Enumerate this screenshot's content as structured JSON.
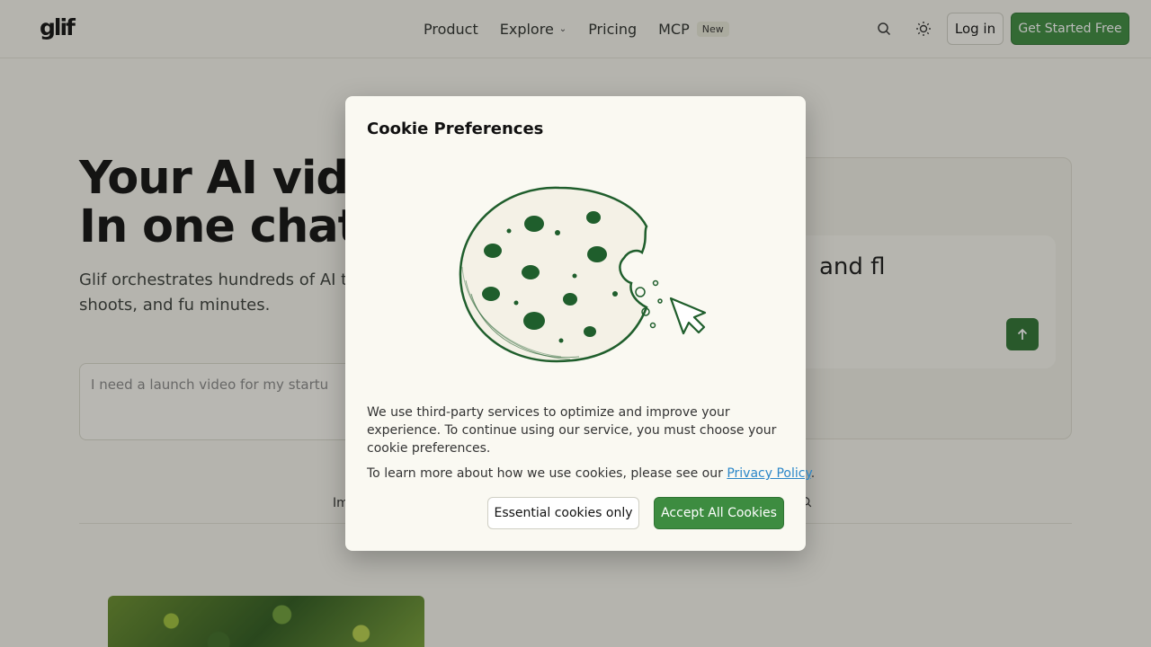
{
  "header": {
    "logo": "glif",
    "nav": {
      "product": "Product",
      "explore": "Explore",
      "pricing": "Pricing",
      "mcp": "MCP",
      "mcp_badge": "New"
    },
    "search_icon": "search-icon",
    "theme_icon": "sun-icon",
    "login_label": "Log in",
    "get_started_label": "Get Started Free"
  },
  "hero": {
    "title_line1": "Your AI vide",
    "title_line2": "In one chat.",
    "subtitle": "Glif orchestrates hundreds of AI to form videos, product shoots, and fu minutes.",
    "prompt_placeholder": "I need a launch video for my startu",
    "preview_text": "and fl"
  },
  "tabs": {
    "fragment": "Im"
  },
  "cookie_modal": {
    "title": "Cookie Preferences",
    "body": "We use third-party services to optimize and improve your experience. To continue using our service, you must choose your cookie preferences.",
    "learn_more_prefix": "To learn more about how we use cookies, please see our ",
    "privacy_link": "Privacy Policy",
    "learn_more_suffix": ".",
    "essential_label": "Essential cookies only",
    "accept_label": "Accept All Cookies"
  },
  "colors": {
    "accent": "#3d8c40",
    "link": "#2a86c8",
    "background": "#f6f5ee"
  }
}
